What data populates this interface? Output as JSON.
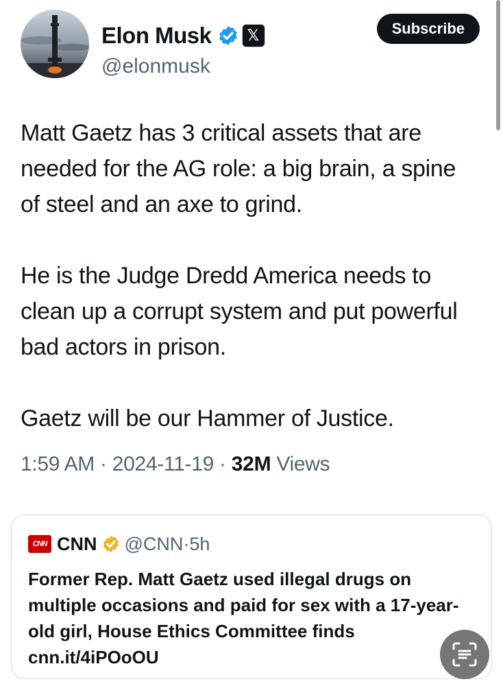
{
  "author": {
    "display_name": "Elon Musk",
    "handle": "@elonmusk",
    "verified_icon": "verified-check-icon",
    "affiliate_icon": "x-logo-icon",
    "subscribe_label": "Subscribe"
  },
  "tweet": {
    "paragraphs": [
      "Matt Gaetz has 3 critical assets that are needed for the AG role: a big brain, a spine of steel and an axe to grind.",
      "He is the Judge Dredd America needs to clean up a corrupt system and put powerful bad actors in prison.",
      "Gaetz will be our Hammer of Justice."
    ],
    "time": "1:59 AM",
    "date": "2024-11-19",
    "views_count": "32M",
    "views_label": "Views",
    "separator": "·"
  },
  "quote": {
    "logo_text": "CNN",
    "name": "CNN",
    "handle": "@CNN",
    "age": "5h",
    "separator": "·",
    "body": "Former Rep. Matt Gaetz used illegal drugs on multiple occasions and paid for sex with a 17-year-old girl, House Ethics Committee finds cnn.it/4iPOoOU"
  },
  "colors": {
    "verified_blue": "#1d9bf0",
    "gold_badge": "#e8b829",
    "cnn_red": "#cc0000"
  },
  "floating_button_icon": "text-recognition-icon"
}
